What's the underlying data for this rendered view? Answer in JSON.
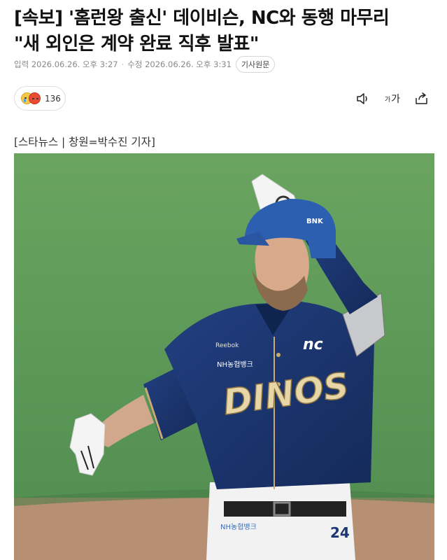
{
  "article": {
    "headline_line1": "[속보] '홈런왕 출신' 데이비슨, NC와 동행 마무리",
    "headline_line2": "\"새 외인은 계약 완료 직후 발표\"",
    "published": "입력 2026.06.26. 오후 3:27",
    "modified": "수정 2026.06.26. 오후 3:31",
    "original_label": "기사원문",
    "byline": "[스타뉴스 | 창원=박수진 기자]"
  },
  "reactions": {
    "count": "136",
    "icons": [
      "sad-face-icon",
      "angry-face-icon"
    ]
  },
  "tools": {
    "audio_icon": "speaker-icon",
    "font_size_small": "가",
    "font_size_large": "가",
    "share_icon": "share-icon"
  },
  "photo": {
    "helmet_text": "BNK",
    "sponsor_text": "NH농협뱅크",
    "jersey_text": "DINOS",
    "team_logo": "nc",
    "number": "24",
    "colors": {
      "grass": "#5e9a5a",
      "dirt": "#b78f73",
      "jersey": "#1b3670",
      "gold": "#c8ad72"
    }
  }
}
